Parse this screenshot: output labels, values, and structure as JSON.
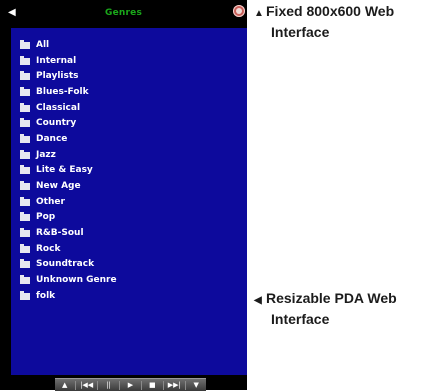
{
  "header": {
    "title": "Genres",
    "back_icon": "arrow-left-icon",
    "home_icon": "home-ball-icon"
  },
  "genres": [
    "All",
    "Internal",
    "Playlists",
    "Blues-Folk",
    "Classical",
    "Country",
    "Dance",
    "Jazz",
    "Lite & Easy",
    "New Age",
    "Other",
    "Pop",
    "R&B-Soul",
    "Rock",
    "Soundtrack",
    "Unknown Genre",
    "folk"
  ],
  "controls": [
    "up-arrow-icon",
    "previous-icon",
    "pause-icon",
    "play-icon",
    "stop-icon",
    "next-icon",
    "down-arrow-icon"
  ],
  "notes": {
    "fixed_line1": "Fixed 800x600 Web",
    "fixed_line2": "Interface",
    "resizable_line1": "Resizable PDA Web",
    "resizable_line2": "Interface"
  },
  "colors": {
    "title": "#1aa81a",
    "content_bg": "#0d0a9c",
    "frame": "#000000"
  }
}
